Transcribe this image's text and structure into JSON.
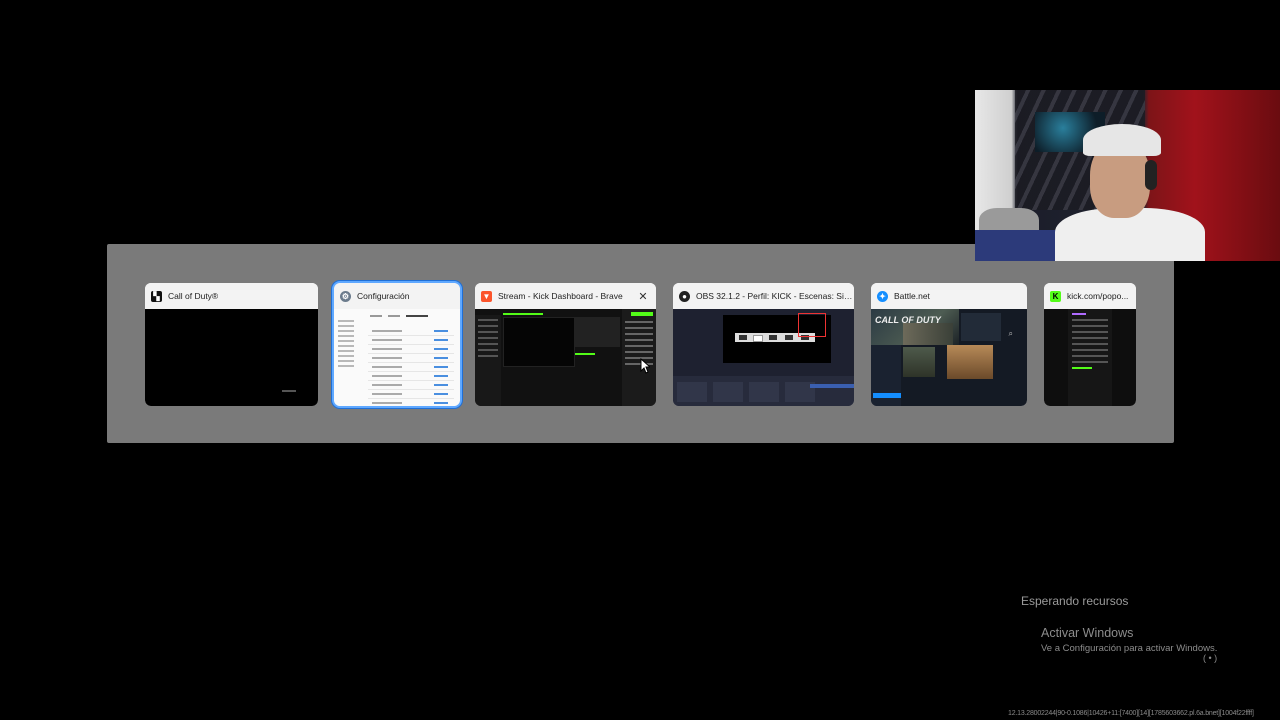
{
  "task_switcher": {
    "windows": [
      {
        "title": "Call of Duty®",
        "icon": "call-of-duty-app-icon",
        "selected": false
      },
      {
        "title": "Configuración",
        "icon": "settings-gear-icon",
        "selected": true
      },
      {
        "title": "Stream - Kick Dashboard - Brave",
        "icon": "brave-browser-icon",
        "selected": false,
        "close": "✕"
      },
      {
        "title": "OBS 32.1.2 - Perfil: KICK - Escenas: Sin Tí...",
        "icon": "obs-studio-icon",
        "selected": false
      },
      {
        "title": "Battle.net",
        "icon": "battlenet-icon",
        "selected": false
      },
      {
        "title": "kick.com/popo...",
        "icon": "kick-icon",
        "selected": false
      }
    ],
    "thumbnail_text": {
      "battlenet_logo": "CALL OF DUTY"
    }
  },
  "overlay": {
    "waiting_text": "Esperando recursos"
  },
  "watermark": {
    "title": "Activar Windows",
    "subtitle": "Ve a Configuración para activar Windows.",
    "tray_glyph": "( • )"
  },
  "build_string": "12.13.28002244|90-0.1086|10426+11:[7400][14][1785603662.pl.6a.bnet][1004f22ffff]",
  "colors": {
    "selection": "#5fa8ff",
    "kick_green": "#53fc18",
    "switcher_bg": "#7a7a7a"
  }
}
